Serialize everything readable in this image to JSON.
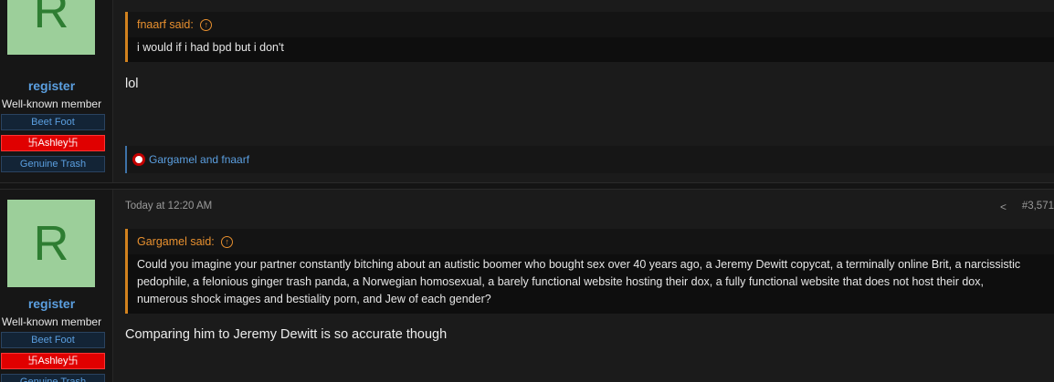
{
  "posts": [
    {
      "user": {
        "avatar_letter": "R",
        "username": "register",
        "title": "Well-known member",
        "banners": [
          "Beet Foot",
          "卐Ashley卐",
          "Genuine Trash"
        ]
      },
      "quote": {
        "author": "fnaarf said:",
        "text": "i would if i had bpd but i don't"
      },
      "message": "lol",
      "reactions": {
        "icon": "swastika-reaction-icon",
        "users": "Gargamel and fnaarf"
      }
    },
    {
      "user": {
        "avatar_letter": "R",
        "username": "register",
        "title": "Well-known member",
        "banners": [
          "Beet Foot",
          "卐Ashley卐",
          "Genuine Trash"
        ]
      },
      "timestamp": "Today at 12:20 AM",
      "post_number": "#3,571",
      "quote": {
        "author": "Gargamel said:",
        "text": "Could you imagine your partner constantly bitching about an autistic boomer who bought sex over 40 years ago, a Jeremy Dewitt copycat, a terminally online Brit, a narcissistic pedophile, a felonious ginger trash panda, a Norwegian homosexual, a barely functional website hosting their dox, a fully functional website that does not host their dox, numerous shock images and bestiality porn, and Jew of each gender?"
      },
      "message": "Comparing him to Jeremy Dewitt is so accurate though"
    }
  ],
  "colors": {
    "link": "#5b9fe0",
    "quote_accent": "#e8902f",
    "banner_red": "#e00000",
    "avatar_bg": "#9ccf9a"
  }
}
